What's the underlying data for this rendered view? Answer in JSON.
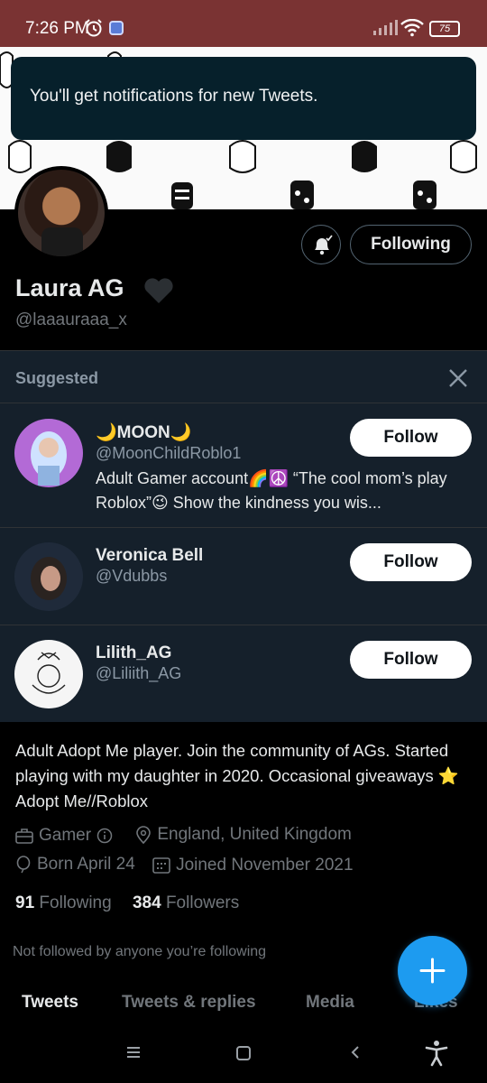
{
  "status_bar": {
    "time": "7:26 PM",
    "battery": "75"
  },
  "toast": {
    "message": "You'll get notifications for new Tweets."
  },
  "profile": {
    "name": "Laura AG",
    "handle": "@laaauraaa_x",
    "following_button": "Following",
    "bio": "Adult Adopt Me player.  Join the community of AGs. Started playing with my daughter in 2020.  Occasional giveaways ⭐  Adopt Me//Roblox",
    "category": "Gamer",
    "location": "England, United Kingdom",
    "birthday": "Born April 24",
    "joined": "Joined November 2021",
    "following_count": "91",
    "following_label": "Following",
    "followers_count": "384",
    "followers_label": "Followers",
    "not_followed": "Not followed by anyone you’re following"
  },
  "suggested": {
    "title": "Suggested",
    "items": [
      {
        "name": "🌙MOON🌙",
        "handle": "@MoonChildRoblo1",
        "bio": "Adult Gamer account🌈☮️  “The cool mom’s play Roblox”😉  Show the kindness you wis...",
        "button": "Follow"
      },
      {
        "name": "Veronica Bell",
        "handle": "@Vdubbs",
        "bio": "",
        "button": "Follow"
      },
      {
        "name": "Lilith_AG",
        "handle": "@Liliith_AG",
        "bio": "",
        "button": "Follow"
      }
    ]
  },
  "tabs": [
    "Tweets",
    "Tweets & replies",
    "Media",
    "Likes"
  ],
  "colors": {
    "accent": "#1d9bf0",
    "status_bar": "#7a3333",
    "suggested_bg": "#15202b"
  }
}
